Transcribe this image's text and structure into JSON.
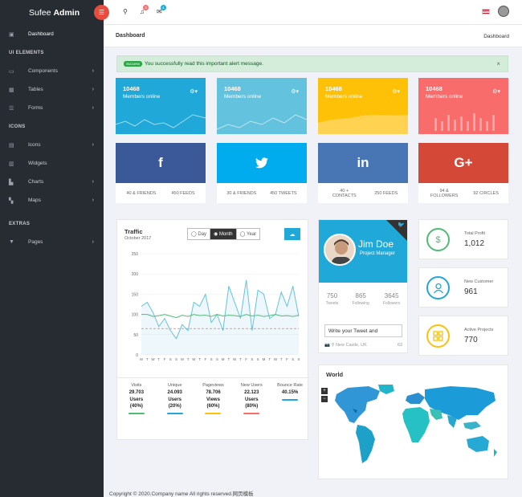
{
  "brand": {
    "light": "Sufee",
    "bold": "Admin"
  },
  "header": {
    "notif_count": "3",
    "mail_count": "4"
  },
  "sidebar": {
    "dashboard": "Dashboard",
    "sections": [
      {
        "title": "UI ELEMENTS",
        "items": [
          "Components",
          "Tables",
          "Forms"
        ]
      },
      {
        "title": "ICONS",
        "items": [
          "Icons",
          "Widgets",
          "Charts",
          "Maps"
        ]
      },
      {
        "title": "EXTRAS",
        "items": [
          "Pages"
        ]
      }
    ]
  },
  "page": {
    "title": "Dashboard",
    "breadcrumb": "Dashboard"
  },
  "alert": {
    "badge": "Success",
    "text": "You successfully read this important alert message."
  },
  "stats": [
    {
      "value": "10468",
      "label": "Members online",
      "color": "#20a8d8"
    },
    {
      "value": "10468",
      "label": "Members online",
      "color": "#63c2de"
    },
    {
      "value": "10468",
      "label": "Members online",
      "color": "#ffc107"
    },
    {
      "value": "10468",
      "label": "Members online",
      "color": "#f86c6b"
    }
  ],
  "social": [
    {
      "icon": "f",
      "name": "facebook",
      "color": "#3b5998",
      "a": "40 & FRIENDS",
      "b": "450 FEEDS"
    },
    {
      "icon": "twitter",
      "name": "twitter",
      "color": "#00aced",
      "a": "30 & FRIENDS",
      "b": "450 TWEETS"
    },
    {
      "icon": "in",
      "name": "linkedin",
      "color": "#4875b4",
      "a": "40 + CONTACTS",
      "b": "250 FEEDS"
    },
    {
      "icon": "G+",
      "name": "google-plus",
      "color": "#d34836",
      "a": "94 & FOLLOWERS",
      "b": "92 CIRCLES"
    }
  ],
  "traffic": {
    "title": "Traffic",
    "subtitle": "October 2017",
    "tabs": [
      "Day",
      "Month",
      "Year"
    ],
    "stats": [
      {
        "label": "Visits",
        "value": "29.703",
        "unit": "Users",
        "pct": "(40%)",
        "color": "#4dbd74"
      },
      {
        "label": "Unique",
        "value": "24.093",
        "unit": "Users",
        "pct": "(20%)",
        "color": "#20a8d8"
      },
      {
        "label": "Pageviews",
        "value": "78.706",
        "unit": "Views",
        "pct": "(60%)",
        "color": "#ffc107"
      },
      {
        "label": "New Users",
        "value": "22.123",
        "unit": "Users",
        "pct": "(80%)",
        "color": "#f86c6b"
      },
      {
        "label": "Bounce Rate",
        "value": "40.15%",
        "unit": "",
        "pct": "",
        "color": "#20a8d8"
      }
    ]
  },
  "chart_data": {
    "type": "line",
    "ylim": [
      0,
      250
    ],
    "yticks": [
      "250",
      "200",
      "150",
      "100",
      "50",
      "0"
    ],
    "x": [
      "M",
      "T",
      "W",
      "T",
      "F",
      "S",
      "S",
      "M",
      "T",
      "W",
      "T",
      "F",
      "S",
      "S",
      "M",
      "T",
      "W",
      "T",
      "F",
      "S",
      "S",
      "M",
      "T",
      "W",
      "T",
      "F",
      "S",
      "S"
    ],
    "series": [
      {
        "values": [
          120,
          130,
          105,
          70,
          90,
          60,
          40,
          75,
          60,
          130,
          120,
          150,
          80,
          100,
          60,
          170,
          130,
          90,
          185,
          60,
          160,
          150,
          90,
          100,
          155,
          120,
          170,
          95
        ]
      },
      {
        "values": [
          100,
          100,
          95,
          97,
          100,
          96,
          92,
          98,
          95,
          100,
          97,
          98,
          95,
          100,
          96,
          98,
          97,
          95,
          100,
          96,
          98,
          95,
          97,
          100,
          96,
          97,
          95,
          98
        ]
      },
      {
        "values": [
          65,
          65,
          65,
          65,
          65,
          65,
          65,
          65,
          65,
          65,
          65,
          65,
          65,
          65,
          65,
          65,
          65,
          65,
          65,
          65,
          65,
          65,
          65,
          65,
          65,
          65,
          65,
          65
        ]
      }
    ]
  },
  "profile": {
    "name": "Jim Doe",
    "role": "Project Manager",
    "stats": [
      {
        "n": "750",
        "l": "Tweets"
      },
      {
        "n": "865",
        "l": "Following"
      },
      {
        "n": "3645",
        "l": "Followers"
      }
    ],
    "tweet_placeholder": "Write your Tweet and",
    "location": "New Castle, UK",
    "count": "63"
  },
  "mini": [
    {
      "label": "Total Profit",
      "value": "1,012",
      "icon": "$",
      "color": "#4dbd74"
    },
    {
      "label": "New Customer",
      "value": "961",
      "icon": "user",
      "color": "#20a8d8"
    },
    {
      "label": "Active Projects",
      "value": "770",
      "icon": "grid",
      "color": "#ffc107"
    }
  ],
  "world": {
    "title": "World"
  },
  "footer": "Copyright © 2020.Company name All rights reserved.网页模板"
}
